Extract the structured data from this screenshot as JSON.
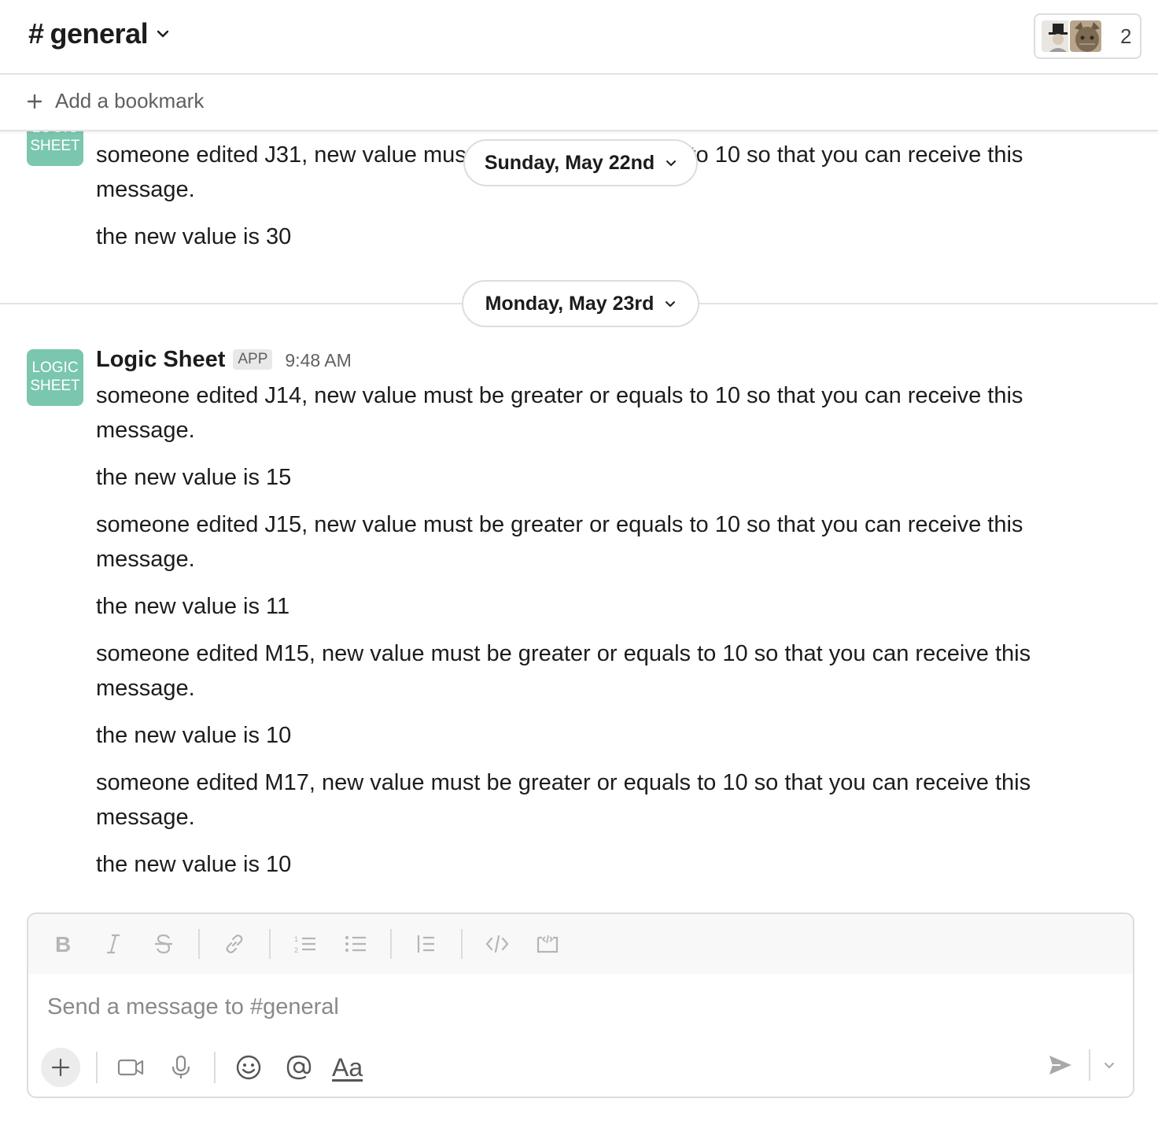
{
  "header": {
    "channel_hash": "#",
    "channel_name": "general",
    "member_count": "2"
  },
  "bookmark": {
    "label": "Add a bookmark"
  },
  "messages": {
    "prev_day_label": "Sunday, May 22nd",
    "prev_line_1": "someone edited J31, new value must be greater or equals to 10 so that you can receive this message.",
    "prev_line_2": "the new value is 30",
    "day_label": "Monday, May 23rd",
    "logo_line_1": "LOGIC",
    "logo_line_2": "SHEET",
    "sender": "Logic Sheet",
    "badge": "APP",
    "time": "9:48 AM",
    "lines": [
      "someone edited J14, new value must be greater or equals to 10 so that you can receive this message.",
      "the new value is 15",
      "someone edited J15, new value must be greater or equals to 10 so that you can receive this message.",
      "the new value is 11",
      "someone edited M15, new value must be greater or equals to 10 so that you can receive this message.",
      "the new value is 10",
      "someone edited M17, new value must be greater or equals to 10 so that you can receive this message.",
      "the new value is 10"
    ]
  },
  "composer": {
    "placeholder": "Send a message to #general",
    "format_label": "Aa",
    "icons": [
      "bold-icon",
      "italic-icon",
      "strikethrough-icon",
      "link-icon",
      "ordered-list-icon",
      "bulleted-list-icon",
      "blockquote-icon",
      "code-icon",
      "code-block-icon",
      "plus-icon",
      "video-icon",
      "microphone-icon",
      "emoji-icon",
      "mention-icon",
      "send-icon",
      "chevron-down-icon"
    ]
  },
  "colors": {
    "logo_bg": "#7ac6ae",
    "border": "#dddddd",
    "muted_text": "#616061"
  }
}
